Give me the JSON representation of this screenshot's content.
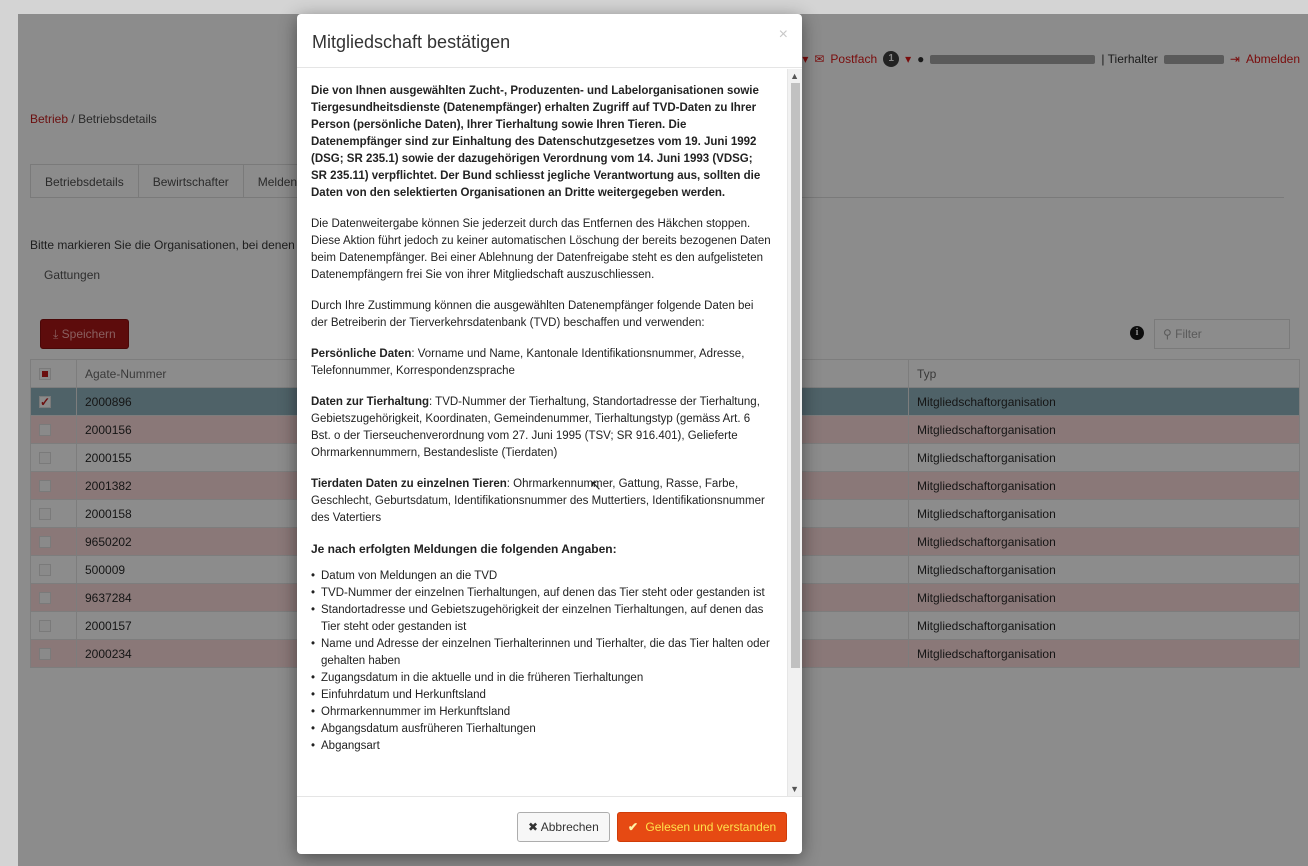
{
  "topnav": {
    "caret1": "▾",
    "mail_icon": "✉",
    "postfach_label": "Postfach",
    "postfach_count": "1",
    "user_icon": "👤",
    "role_label": "| Tierhalter",
    "logout_label": "Abmelden",
    "logout_icon": "⇥"
  },
  "breadcrumb": {
    "root": "Betrieb",
    "separator": "/",
    "current": "Betriebsdetails"
  },
  "tabs": [
    "Betriebsdetails",
    "Bewirtschafter",
    "Meldend"
  ],
  "intro_text": "Bitte markieren Sie die Organisationen, bei denen",
  "gattungen_label": "Gattungen",
  "save_button": "Speichern",
  "filter_placeholder": "Filter",
  "table": {
    "headers": {
      "number": "Agate-Nummer",
      "type": "Typ"
    },
    "rows": [
      {
        "number": "2000896",
        "type": "Mitgliedschaftorganisation",
        "checked": true
      },
      {
        "number": "2000156",
        "type": "Mitgliedschaftorganisation",
        "checked": false
      },
      {
        "number": "2000155",
        "type": "Mitgliedschaftorganisation",
        "checked": false
      },
      {
        "number": "2001382",
        "type": "Mitgliedschaftorganisation",
        "checked": false
      },
      {
        "number": "2000158",
        "type": "Mitgliedschaftorganisation",
        "checked": false
      },
      {
        "number": "9650202",
        "type": "Mitgliedschaftorganisation",
        "checked": false
      },
      {
        "number": "500009",
        "type": "Mitgliedschaftorganisation",
        "checked": false
      },
      {
        "number": "9637284",
        "type": "Mitgliedschaftorganisation",
        "checked": false
      },
      {
        "number": "2000157",
        "type": "Mitgliedschaftorganisation",
        "checked": false
      },
      {
        "number": "2000234",
        "type": "Mitgliedschaftorganisation",
        "checked": false
      }
    ]
  },
  "modal": {
    "title": "Mitgliedschaft bestätigen",
    "close": "×",
    "intro_bold": "Die von Ihnen ausgewählten Zucht-, Produzenten- und Labelorganisationen sowie Tiergesundheitsdienste (Datenempfänger) erhalten Zugriff auf TVD-Daten zu Ihrer Person (persönliche Daten), Ihrer Tierhaltung sowie Ihren Tieren. Die Datenempfänger sind zur Einhaltung des Datenschutzgesetzes vom 19. Juni 1992 (DSG; SR 235.1) sowie der dazugehörigen Verordnung vom 14. Juni 1993 (VDSG; SR 235.11) verpflichtet. Der Bund schliesst jegliche Verantwortung aus, sollten die Daten von den selektierten Organisationen an Dritte weitergegeben werden.",
    "para_stop": "Die Datenweitergabe können Sie jederzeit durch das Entfernen des Häkchen stoppen. Diese Aktion führt jedoch zu keiner automatischen Löschung der bereits bezogenen Daten beim Datenempfänger. Bei einer Ablehnung der Datenfreigabe steht es den aufgelisteten Datenempfängern frei Sie von ihrer Mitgliedschaft auszuschliessen.",
    "para_consent": "Durch Ihre Zustimmung können die ausgewählten Datenempfänger folgende Daten bei der Betreiberin der Tierverkehrsdatenbank (TVD) beschaffen und verwenden:",
    "personal_label": "Persönliche Daten",
    "personal_text": ": Vorname und Name, Kantonale Identifikationsnummer, Adresse, Telefonnummer, Korrespondenzsprache",
    "holding_label": "Daten zur Tierhaltung",
    "holding_text": ": TVD-Nummer der Tierhaltung, Standortadresse der Tierhaltung, Gebietszugehörigkeit, Koordinaten, Gemeindenummer, Tierhaltungstyp (gemäss Art. 6 Bst. o der Tierseuchenverordnung vom 27. Juni 1995 (TSV; SR 916.401), Gelieferte Ohrmarkennummern, Bestandesliste (Tierdaten)",
    "animal_label": "Tierdaten Daten zu einzelnen Tieren",
    "animal_text": ": Ohrmarkennummer, Gattung, Rasse, Farbe, Geschlecht, Geburtsdatum, Identifikationsnummer des Muttertiers, Identifikationsnummer des Vatertiers",
    "list_heading": "Je nach erfolgten Meldungen die folgenden Angaben:",
    "list_items": [
      "Datum von Meldungen an die TVD",
      "TVD-Nummer der einzelnen Tierhaltungen, auf denen das Tier steht oder gestanden ist",
      "Standortadresse und Gebietszugehörigkeit der einzelnen Tierhaltungen, auf denen das Tier steht oder gestanden ist",
      "Name und Adresse der einzelnen Tierhalterinnen und Tierhalter, die das Tier halten oder gehalten haben",
      "Zugangsdatum in die aktuelle und in die früheren Tierhaltungen",
      "Einfuhrdatum und Herkunftsland",
      "Ohrmarkennummer im Herkunftsland",
      "Abgangsdatum ausfrüheren Tierhaltungen",
      "Abgangsart"
    ],
    "cancel_label": "Abbrechen",
    "cancel_icon": "✖",
    "ok_label": "Gelesen und verstanden",
    "ok_icon": "✔"
  },
  "colors": {
    "accent": "#e64a13",
    "brand_red": "#b81414",
    "overlay": "#8c8c8c"
  }
}
